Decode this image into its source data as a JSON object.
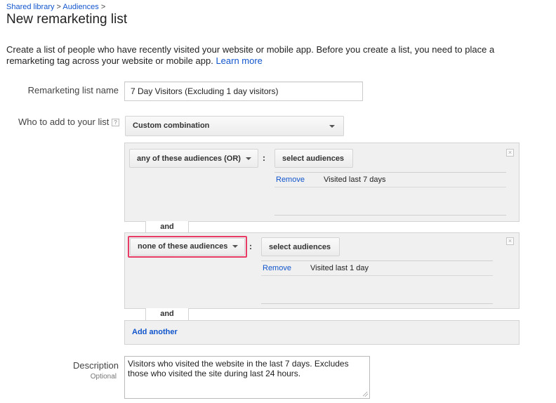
{
  "breadcrumb": {
    "shared_library": "Shared library",
    "sep1": " > ",
    "audiences": "Audiences",
    "sep2": " >"
  },
  "page_title": "New remarketing list",
  "intro": {
    "text": "Create a list of people who have recently visited your website or mobile app. Before you create a list, you need to place a remarketing tag across your website or mobile app.",
    "learn_more": "Learn more"
  },
  "form": {
    "name_label": "Remarketing list name",
    "name_value": "7 Day Visitors (Excluding 1 day visitors)",
    "who_label": "Who to add to your list",
    "help_glyph": "?",
    "who_select": "Custom combination"
  },
  "rules": [
    {
      "operator": "any of these audiences (OR)",
      "colon": ":",
      "select_button": "select audiences",
      "audiences": [
        {
          "remove": "Remove",
          "name": "Visited last 7 days"
        }
      ]
    },
    {
      "operator": "none of these audiences",
      "colon": ":",
      "select_button": "select audiences",
      "audiences": [
        {
          "remove": "Remove",
          "name": "Visited last 1 day"
        }
      ]
    }
  ],
  "connector": "and",
  "add_another": "Add another",
  "description": {
    "label": "Description",
    "optional": "Optional",
    "value": "Visitors who visited the website in the last 7 days. Excludes those who visited the site during last 24 hours."
  },
  "colors": {
    "link": "#1155cc",
    "highlight": "#e83c66",
    "panel": "#f0f0f0",
    "border": "#d3d3d3"
  },
  "icons": {
    "close": "close-icon",
    "dropdown": "chevron-down-icon",
    "help": "help-icon",
    "resize": "resize-grip-icon"
  }
}
